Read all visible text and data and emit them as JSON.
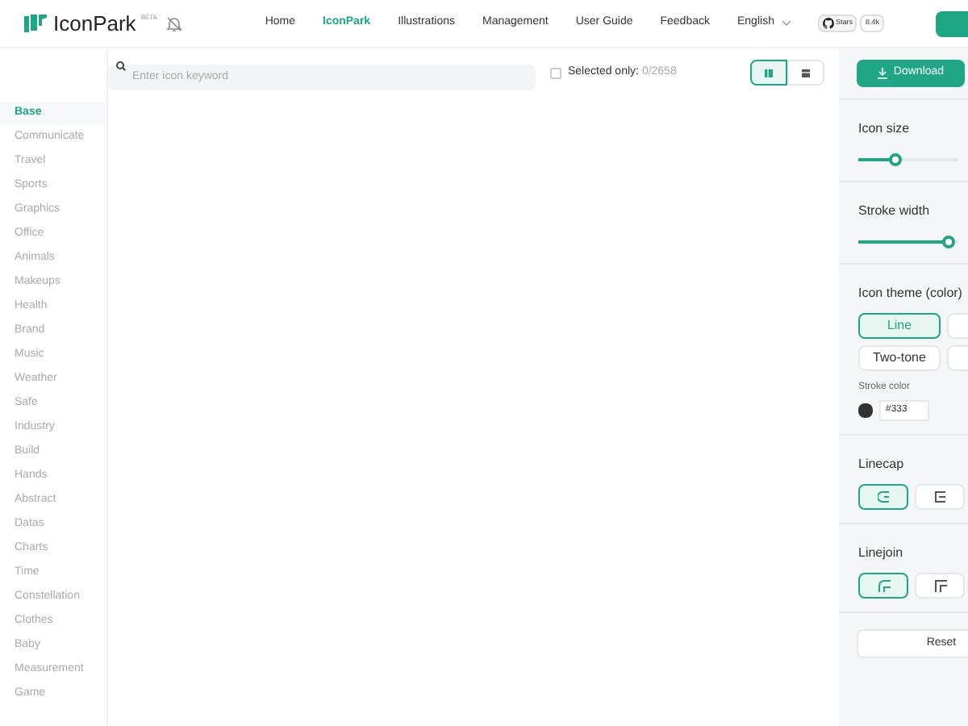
{
  "header": {
    "logo": "IconPark",
    "badge": "BETA",
    "nav": [
      {
        "label": "Home",
        "selected": false
      },
      {
        "label": "IconPark",
        "selected": true
      },
      {
        "label": "Illustrations",
        "selected": false
      },
      {
        "label": "Management",
        "selected": false
      },
      {
        "label": "User Guide",
        "selected": false
      },
      {
        "label": "Feedback",
        "selected": false
      }
    ],
    "language": "English",
    "stars_label": "Stars",
    "stars_count": "8.4k"
  },
  "toolbar": {
    "search": {
      "placeholder": "Enter icon keyword"
    },
    "selected_only": {
      "label": "Selected only:",
      "count": "0/2658",
      "checked": false
    },
    "views": [
      {
        "kind": "grid",
        "selected": true
      },
      {
        "kind": "list",
        "selected": false
      }
    ]
  },
  "sidebar": {
    "items": [
      {
        "label": "Base",
        "selected": true
      },
      {
        "label": "Communicate",
        "selected": false
      },
      {
        "label": "Travel",
        "selected": false
      },
      {
        "label": "Sports",
        "selected": false
      },
      {
        "label": "Graphics",
        "selected": false
      },
      {
        "label": "Office",
        "selected": false
      },
      {
        "label": "Animals",
        "selected": false
      },
      {
        "label": "Makeups",
        "selected": false
      },
      {
        "label": "Health",
        "selected": false
      },
      {
        "label": "Brand",
        "selected": false
      },
      {
        "label": "Music",
        "selected": false
      },
      {
        "label": "Weather",
        "selected": false
      },
      {
        "label": "Safe",
        "selected": false
      },
      {
        "label": "Industry",
        "selected": false
      },
      {
        "label": "Build",
        "selected": false
      },
      {
        "label": "Hands",
        "selected": false
      },
      {
        "label": "Abstract",
        "selected": false
      },
      {
        "label": "Datas",
        "selected": false
      },
      {
        "label": "Charts",
        "selected": false
      },
      {
        "label": "Time",
        "selected": false
      },
      {
        "label": "Constellation",
        "selected": false
      },
      {
        "label": "Clothes",
        "selected": false
      },
      {
        "label": "Baby",
        "selected": false
      },
      {
        "label": "Measurement",
        "selected": false
      },
      {
        "label": "Game",
        "selected": false
      }
    ]
  },
  "panel": {
    "download": "Download",
    "icon_size": {
      "label": "Icon size",
      "level": 0.37
    },
    "stroke_width": {
      "label": "Stroke width",
      "level": 0.9
    },
    "theme": {
      "label": "Icon theme (color)",
      "options": [
        {
          "label": "Line",
          "selected": true
        },
        {
          "selected": false
        },
        {
          "label": "Two-tone",
          "selected": false
        },
        {
          "selected": false
        }
      ]
    },
    "stroke_color": {
      "label": "Stroke color",
      "value": "#333",
      "color": "#333333"
    },
    "linecap": {
      "label": "Linecap",
      "options": [
        {
          "kind": "round",
          "selected": true
        },
        {
          "kind": "butt",
          "selected": false
        }
      ]
    },
    "linejoin": {
      "label": "Linejoin",
      "options": [
        {
          "kind": "round",
          "selected": true
        },
        {
          "kind": "miter",
          "selected": false
        }
      ]
    },
    "reset": "Reset"
  }
}
